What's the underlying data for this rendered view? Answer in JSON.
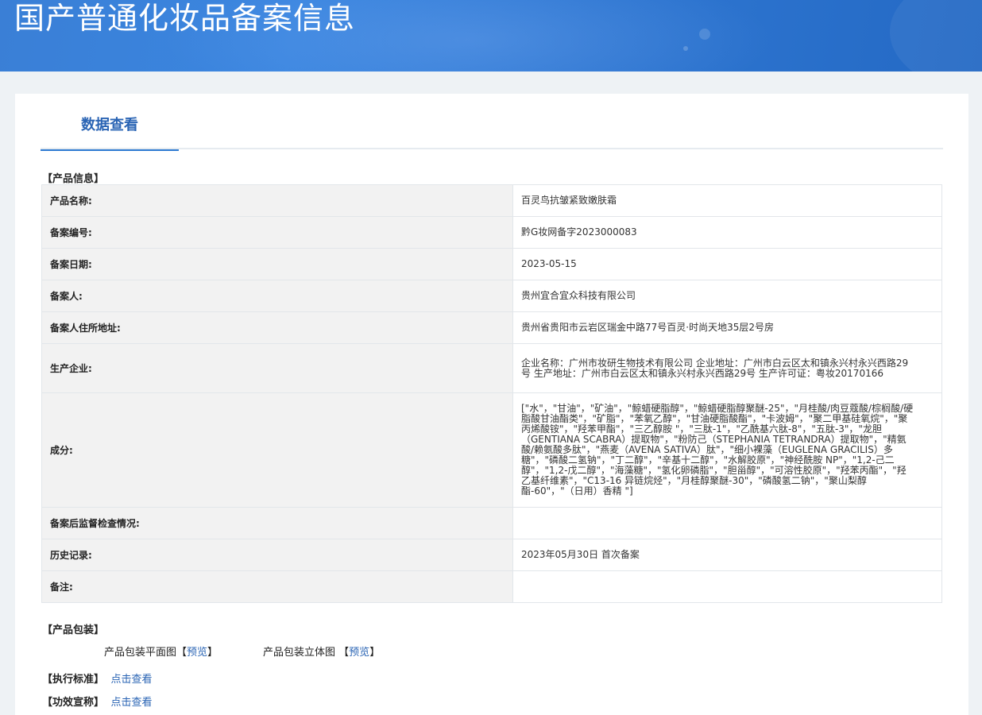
{
  "header": {
    "title": "国产普通化妆品备案信息"
  },
  "tabs": [
    {
      "label": "数据查看"
    }
  ],
  "product_info": {
    "section_label": "【产品信息】",
    "rows": [
      {
        "label": "产品名称:",
        "value": "百灵鸟抗皱紧致嫩肤霜"
      },
      {
        "label": "备案编号:",
        "value": "黔G妆网备字2023000083"
      },
      {
        "label": "备案日期:",
        "value": "2023-05-15"
      },
      {
        "label": "备案人:",
        "value": "贵州宜合宜众科技有限公司"
      },
      {
        "label": "备案人住所地址:",
        "value": "贵州省贵阳市云岩区瑞金中路77号百灵·时尚天地35层2号房"
      },
      {
        "label": "生产企业:",
        "value": "企业名称：广州市妆研生物技术有限公司 企业地址：广州市白云区太和镇永兴村永兴西路29号 生产地址：广州市白云区太和镇永兴村永兴西路29号 生产许可证：粤妆20170166"
      },
      {
        "label": "成分:",
        "value": "[\"水\"，\"甘油\"，\"矿油\"，\"鲸蜡硬脂醇\"，\"鲸蜡硬脂醇聚醚-25\"，\"月桂酸/肉豆蔻酸/棕榈酸/硬脂酸甘油酯类\"，\"矿脂\"，\"苯氧乙醇\"，\"甘油硬脂酸酯\"，\"卡波姆\"，\"聚二甲基硅氧烷\"，\"聚丙烯酸铵\"，\"羟苯甲酯\"，\"三乙醇胺 \"，\"三肽-1\"，\"乙酰基六肽-8\"，\"五肽-3\"，\"龙胆（GENTIANA SCABRA）提取物\"，\"粉防己（STEPHANIA TETRANDRA）提取物\"，\"精氨酸/赖氨酸多肽\"，\"燕麦（AVENA SATIVA）肽\"，\"细小裸藻（EUGLENA GRACILIS）多糖\"，\"磷酸二氢钠\"，\"丁二醇\"，\"辛基十二醇\"，\"水解胶原\"，\"神经酰胺 NP\"，\"1,2-己二醇\"，\"1,2-戊二醇\"，\"海藻糖\"，\"氢化卵磷脂\"，\"胆甾醇\"，\"可溶性胶原\"，\"羟苯丙酯\"，\"羟乙基纤维素\"，\"C13-16 异链烷烃\"，\"月桂醇聚醚-30\"，\"磷酸氢二钠\"，\"聚山梨醇酯-60\"，\"（日用）香精 \"]"
      },
      {
        "label": "备案后监督检查情况:",
        "value": ""
      },
      {
        "label": "历史记录:",
        "value": "2023年05月30日 首次备案"
      },
      {
        "label": "备注:",
        "value": ""
      }
    ]
  },
  "packaging": {
    "section_label": "【产品包装】",
    "flat_label": "产品包装平面图",
    "flat_bracket_open": "【",
    "flat_link": "预览",
    "flat_bracket_close": "】",
    "solid_label": "产品包装立体图",
    "solid_bracket_open": "【",
    "solid_link": "预览",
    "solid_bracket_close": "】"
  },
  "standard": {
    "section_label": "【执行标准】",
    "link": "点击查看"
  },
  "efficacy": {
    "section_label": "【功效宣称】",
    "link": "点击查看"
  }
}
